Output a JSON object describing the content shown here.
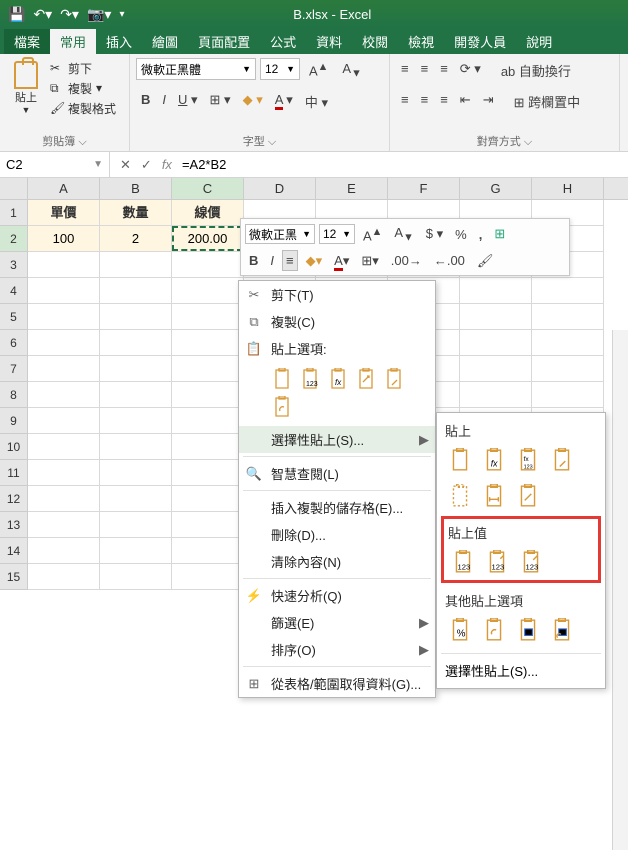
{
  "titlebar": {
    "title": "B.xlsx - Excel"
  },
  "tabs": {
    "file": "檔案",
    "home": "常用",
    "insert": "插入",
    "draw": "繪圖",
    "layout": "頁面配置",
    "formulas": "公式",
    "data": "資料",
    "review": "校閱",
    "view": "檢視",
    "dev": "開發人員",
    "help": "說明"
  },
  "ribbon": {
    "paste": "貼上",
    "cut": "剪下",
    "copy": "複製",
    "format_painter": "複製格式",
    "clipboard_label": "剪貼簿",
    "font_name": "微軟正黑體",
    "font_size": "12",
    "font_label": "字型",
    "align_label": "對齊方式",
    "wrap": "自動換行",
    "merge": "跨欄置中"
  },
  "namebox": "C2",
  "formula": "=A2*B2",
  "cols": [
    "A",
    "B",
    "C",
    "D",
    "E",
    "F",
    "G",
    "H"
  ],
  "headers": {
    "a": "單價",
    "b": "數量",
    "c": "線價"
  },
  "row2": {
    "a": "100",
    "b": "2",
    "c": "200.00",
    "overlay": "=A2*B2"
  },
  "mini": {
    "font": "微軟正黑",
    "size": "12"
  },
  "ctx": {
    "cut": "剪下(T)",
    "copy": "複製(C)",
    "paste_opts": "貼上選項:",
    "paste_special": "選擇性貼上(S)...",
    "smart_lookup": "智慧查閱(L)",
    "insert_copied": "插入複製的儲存格(E)...",
    "delete": "刪除(D)...",
    "clear": "清除內容(N)",
    "quick_analysis": "快速分析(Q)",
    "filter": "篩選(E)",
    "sort": "排序(O)",
    "from_table": "從表格/範圍取得資料(G)..."
  },
  "submenu": {
    "paste": "貼上",
    "paste_values": "貼上值",
    "other": "其他貼上選項",
    "paste_special": "選擇性貼上(S)..."
  }
}
